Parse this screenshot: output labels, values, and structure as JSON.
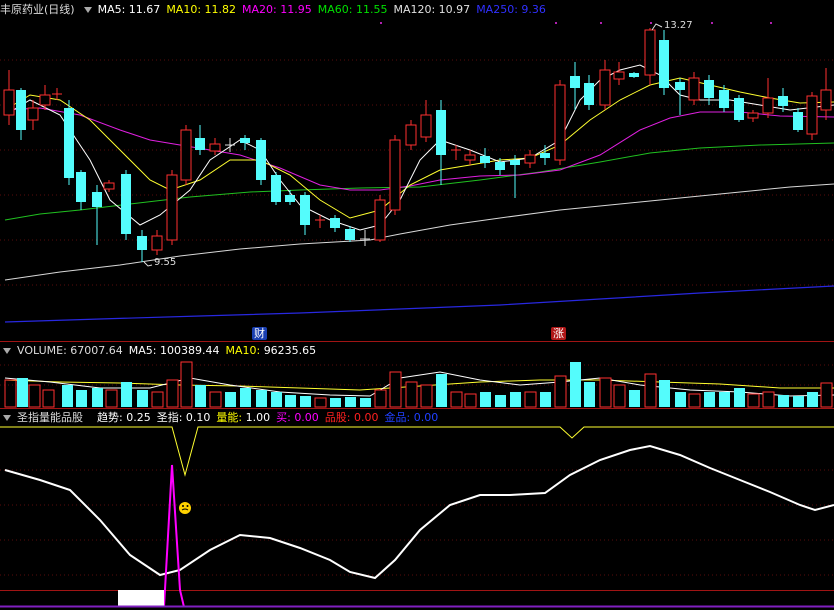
{
  "price_panel": {
    "stock_title": "丰原药业(日线)",
    "ma": [
      {
        "label": "MA5: 11.67",
        "color": "#ffffff"
      },
      {
        "label": "MA10: 11.82",
        "color": "#ffff00"
      },
      {
        "label": "MA20: 11.95",
        "color": "#ff00ff"
      },
      {
        "label": "MA60: 11.55",
        "color": "#00e000"
      },
      {
        "label": "MA120: 10.97",
        "color": "#e0e0e0"
      },
      {
        "label": "MA250: 9.36",
        "color": "#3030ff"
      }
    ],
    "high_label": "13.27",
    "low_label": "9.55",
    "tag_cai": "财",
    "tag_zhang": "涨"
  },
  "volume_panel": {
    "title": "VOLUME: 67007.64",
    "ma5": "MA5: 100389.44",
    "ma10_label": "MA10: ",
    "ma10_value": "96235.65"
  },
  "indicator_panel": {
    "name": "圣指量能品股",
    "items": [
      {
        "k": "趋势: ",
        "v": "0.25",
        "kc": "#ffffff",
        "vc": "#ffffff"
      },
      {
        "k": "圣指: ",
        "v": "0.10",
        "kc": "#ffffff",
        "vc": "#ffffff"
      },
      {
        "k": "量能: ",
        "v": "1.00",
        "kc": "#ffff00",
        "vc": "#ffffff"
      },
      {
        "k": "买: ",
        "v": "0.00",
        "kc": "#ff00ff",
        "vc": "#ff00ff"
      },
      {
        "k": "品股: ",
        "v": "0.00",
        "kc": "#ff2020",
        "vc": "#ff2020"
      },
      {
        "k": "金品: ",
        "v": "0.00",
        "kc": "#2040ff",
        "vc": "#2040ff"
      }
    ]
  },
  "colors": {
    "up": "#ff3030",
    "down": "#54fcfc",
    "grid": "#8a1010"
  }
}
